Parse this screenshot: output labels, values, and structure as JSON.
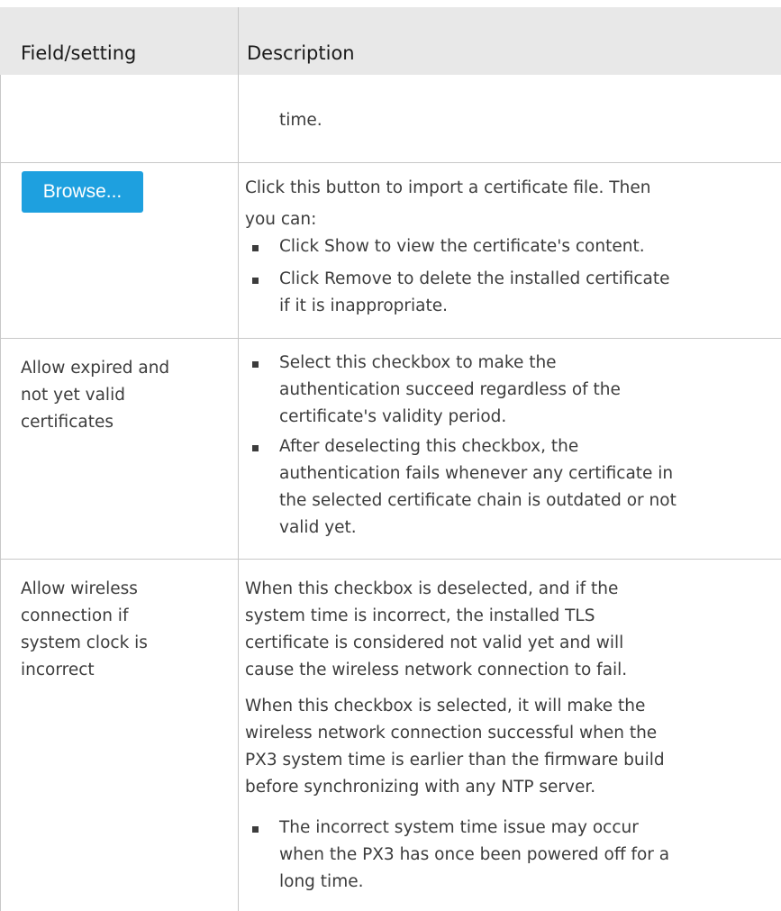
{
  "header": {
    "col1": "Field/setting",
    "col2": "Description"
  },
  "row0": {
    "desc": "time."
  },
  "row1": {
    "button_label": "Browse...",
    "desc_lines": [
      "Click this button to import a certificate file. Then",
      "you can:"
    ],
    "bullets": [
      [
        "Click Show to view the certificate's content."
      ],
      [
        "Click Remove to delete the installed certificate",
        "if it is inappropriate."
      ]
    ]
  },
  "row2": {
    "field_lines": [
      "Allow expired and",
      "not yet valid",
      "certificates"
    ],
    "bullets": [
      [
        "Select this checkbox to make the",
        "authentication succeed regardless of the",
        "certificate's validity period."
      ],
      [
        "After deselecting this checkbox, the",
        "authentication fails whenever any certificate in",
        "the selected certificate chain is outdated or not",
        "valid yet."
      ]
    ]
  },
  "row3": {
    "field_lines": [
      "Allow wireless",
      "connection if",
      "system clock is",
      "incorrect"
    ],
    "para1": [
      "When this checkbox is deselected, and if the",
      "system time is incorrect, the installed TLS",
      "certificate is considered not valid yet and will",
      "cause the wireless network connection to fail."
    ],
    "para2": [
      "When this checkbox is selected, it will make the",
      "wireless network connection successful when the",
      "PX3 system time is earlier than the firmware build",
      "before synchronizing with any NTP server."
    ],
    "bullets": [
      [
        "The incorrect system time issue may occur",
        "when the PX3 has once been powered off for a",
        "long time."
      ]
    ]
  }
}
